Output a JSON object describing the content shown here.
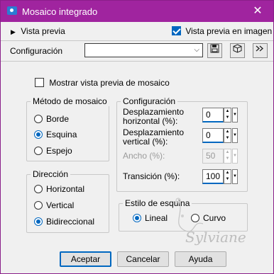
{
  "window": {
    "title": "Mosaico integrado",
    "close_glyph": "✕"
  },
  "preview": {
    "label": "Vista previa",
    "checkbox_label": "Vista previa en imagen",
    "checkbox_checked": true
  },
  "config_bar": {
    "label": "Configuración",
    "combo_value": "",
    "icons": [
      "save-icon",
      "preset-icon",
      "reset-icon"
    ]
  },
  "mosaic_preview": {
    "label": "Mostrar vista previa de mosaico",
    "checked": false
  },
  "method": {
    "title": "Método de mosaico",
    "options": [
      "Borde",
      "Esquina",
      "Espejo"
    ],
    "selected": "Esquina"
  },
  "direction": {
    "title": "Dirección",
    "options": [
      "Horizontal",
      "Vertical",
      "Bidireccional"
    ],
    "selected": "Bidireccional"
  },
  "settings": {
    "title": "Configuración",
    "h_offset_label": "Desplazamiento horizontal (%):",
    "h_offset_line1": "Desplazamiento",
    "h_offset_line2": "horizontal (%):",
    "h_offset_value": "0",
    "v_offset_line1": "Desplazamiento",
    "v_offset_line2": "vertical (%):",
    "v_offset_value": "0",
    "width_label": "Ancho (%):",
    "width_value": "50",
    "transition_label": "Transición (%):",
    "transition_value": "100"
  },
  "corner_style": {
    "title": "Estilo de esquina",
    "options": [
      "Lineal",
      "Curvo"
    ],
    "selected": "Lineal"
  },
  "buttons": {
    "ok": "Aceptar",
    "cancel": "Cancelar",
    "help": "Ayuda"
  },
  "watermark": {
    "text": "Sylviane"
  },
  "colors": {
    "titlebar": "#a0249f",
    "accent": "#0067c0"
  }
}
